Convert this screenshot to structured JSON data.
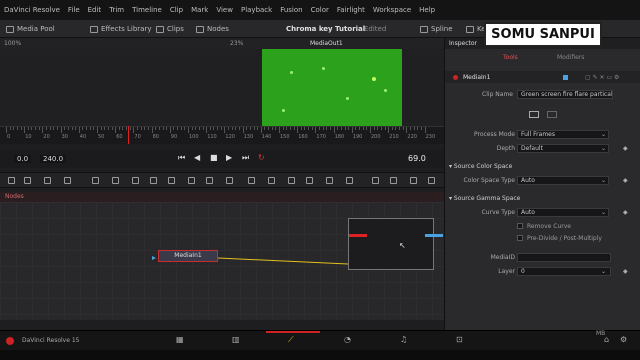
{
  "menubar": [
    "DaVinci Resolve",
    "File",
    "Edit",
    "Trim",
    "Timeline",
    "Clip",
    "Mark",
    "View",
    "Playback",
    "Fusion",
    "Color",
    "Fairlight",
    "Workspace",
    "Help"
  ],
  "toolbar": {
    "media_pool": "Media Pool",
    "effects_library": "Effects Library",
    "clips": "Clips",
    "nodes": "Nodes",
    "project_title": "Chroma key Tutorial",
    "edited": "Edited",
    "spline": "Spline",
    "keyframes": "Keyf",
    "inspector": "Inspector"
  },
  "viewer": {
    "zoom_left": "100%",
    "zoom_right": "23%",
    "output_name": "MediaOut1"
  },
  "ruler": {
    "labels": [
      "0",
      "10",
      "20",
      "30",
      "40",
      "50",
      "60",
      "70",
      "80",
      "90",
      "100",
      "110",
      "120",
      "130",
      "140",
      "150",
      "160",
      "170",
      "180",
      "190",
      "200",
      "210",
      "220",
      "230"
    ]
  },
  "transport": {
    "start": "0.0",
    "end": "240.0",
    "current": "69.0"
  },
  "nodes": {
    "header": "Nodes",
    "node_label": "MediaIn1"
  },
  "inspector": {
    "tab_tools": "Tools",
    "tab_modifiers": "Modifiers",
    "node_name": "MediaIn1",
    "clip_name_label": "Clip Name",
    "clip_name_value": "Green screen fire flare partical.mp4",
    "process_mode_label": "Process Mode",
    "process_mode_value": "Full Frames",
    "depth_label": "Depth",
    "depth_value": "Default",
    "source_color_space": "Source Color Space",
    "color_space_type_label": "Color Space Type",
    "color_space_type_value": "Auto",
    "source_gamma_space": "Source Gamma Space",
    "curve_type_label": "Curve Type",
    "curve_type_value": "Auto",
    "remove_curve": "Remove Curve",
    "pre_divide": "Pre-Divide / Post-Multiply",
    "mediaid_label": "MediaID",
    "layer_label": "Layer",
    "layer_value": "0"
  },
  "status": {
    "app": "DaVinci Resolve 15",
    "memory": "40% - 1601 MB"
  },
  "watermark": "SOMU SANPUI",
  "colors": {
    "clip_green": "#2ca11c",
    "accent_red": "#c23030",
    "link_yellow": "#e0c020"
  }
}
